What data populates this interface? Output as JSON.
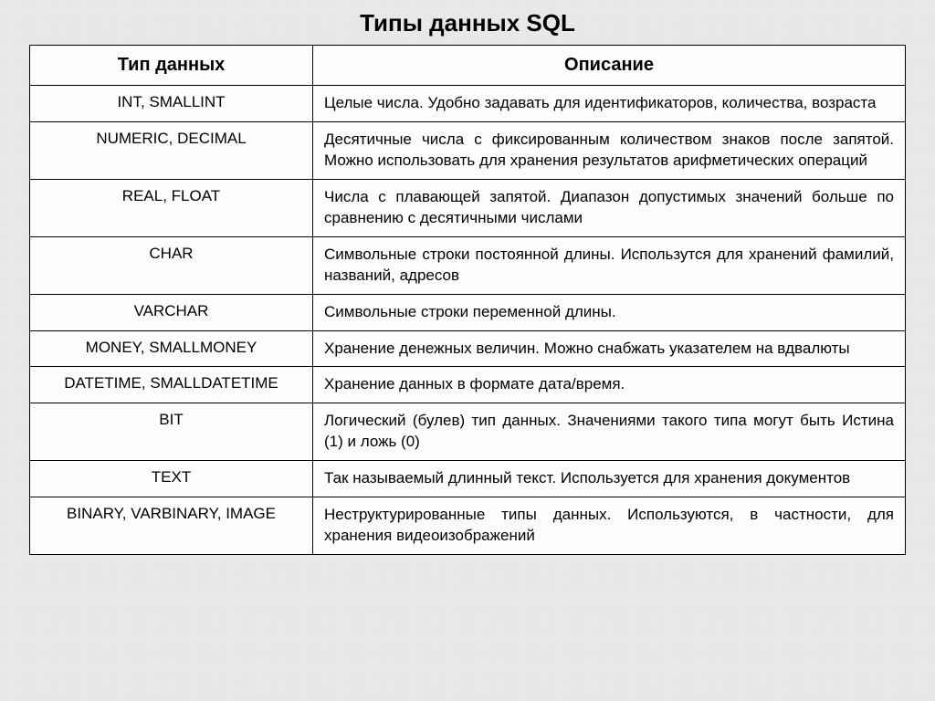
{
  "title": "Типы данных SQL",
  "headers": {
    "type": "Тип данных",
    "description": "Описание"
  },
  "rows": [
    {
      "type": "INT, SMALLINT",
      "description": "Целые числа. Удобно задавать для идентификаторов, количества, возраста"
    },
    {
      "type": "NUMERIC, DECIMAL",
      "description": "Десятичные числа с фиксированным количеством знаков после запятой. Можно использовать для хранения результатов арифметических операций"
    },
    {
      "type": "REAL, FLOAT",
      "description": "Числа с плавающей запятой. Диапазон допустимых значений больше по сравнению с десятичными числами"
    },
    {
      "type": "CHAR",
      "description": "Символьные строки постоянной длины. Использутся для хранений фамилий, названий, адресов"
    },
    {
      "type": "VARCHAR",
      "description": "Символьные строки переменной длины."
    },
    {
      "type": "MONEY, SMALLMONEY",
      "description": "Хранение денежных величин. Можно снабжать указателем на вдвалюты"
    },
    {
      "type": "DATETIME, SMALLDATETIME",
      "description": "Хранение данных в формате дата/время."
    },
    {
      "type": "BIT",
      "description": "Логический (булев) тип данных. Значениями такого типа могут быть Истина (1) и ложь (0)"
    },
    {
      "type": "TEXT",
      "description": "Так называемый длинный текст. Используется для хранения документов"
    },
    {
      "type": "BINARY, VARBINARY, IMAGE",
      "description": "Неструктурированные типы данных. Используются, в частности, для хранения видеоизображений"
    }
  ]
}
